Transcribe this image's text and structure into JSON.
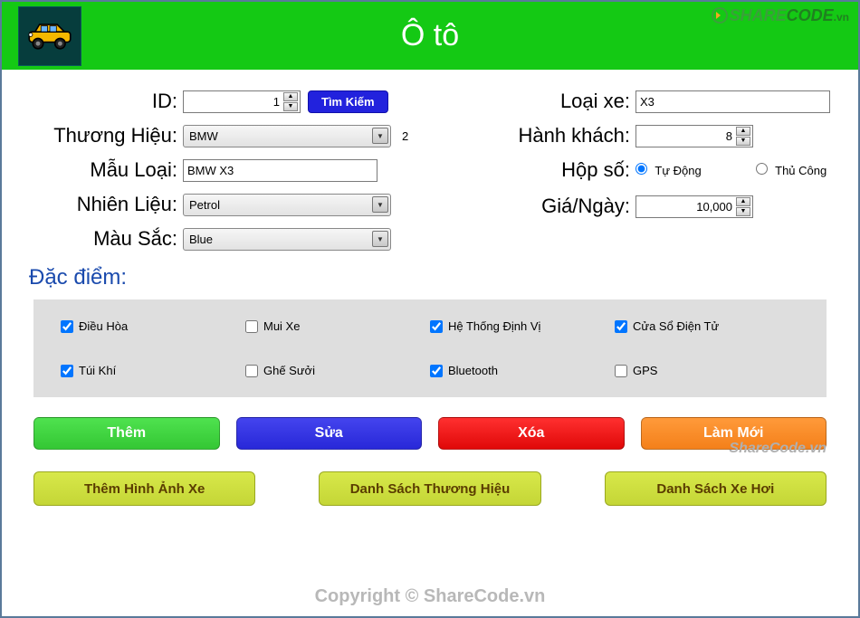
{
  "header": {
    "title": "Ô tô"
  },
  "watermarks": {
    "top_share": "SHARE",
    "top_code": "CODE",
    "top_vn": ".vn",
    "mid": "ShareCode.vn",
    "copyright": "Copyright © ShareCode.vn"
  },
  "labels": {
    "id": "ID:",
    "brand": "Thương Hiệu:",
    "model": "Mẫu Loại:",
    "fuel": "Nhiên Liệu:",
    "color": "Màu Sắc:",
    "car_type": "Loại xe:",
    "passengers": "Hành khách:",
    "gearbox": "Hộp số:",
    "price_day": "Giá/Ngày:",
    "features": "Đặc điểm:"
  },
  "values": {
    "id": "1",
    "brand": "BMW",
    "brand_side": "2",
    "model": "BMW X3",
    "fuel": "Petrol",
    "color": "Blue",
    "car_type": "X3",
    "passengers": "8",
    "price_day": "10,000"
  },
  "gearbox": {
    "auto": "Tự Động",
    "manual": "Thủ Công",
    "selected": "auto"
  },
  "features": [
    {
      "label": "Điều Hòa",
      "checked": true
    },
    {
      "label": "Mui Xe",
      "checked": false
    },
    {
      "label": "Hệ Thống Định Vị",
      "checked": true
    },
    {
      "label": "Cửa Sổ Điện Tử",
      "checked": true
    },
    {
      "label": "Túi Khí",
      "checked": true
    },
    {
      "label": "Ghế Sưởi",
      "checked": false
    },
    {
      "label": "Bluetooth",
      "checked": true
    },
    {
      "label": "GPS",
      "checked": false
    }
  ],
  "buttons": {
    "search": "Tìm Kiếm",
    "add": "Thêm",
    "edit": "Sửa",
    "delete": "Xóa",
    "refresh": "Làm Mới",
    "add_image": "Thêm Hình Ảnh Xe",
    "brand_list": "Danh Sách Thương Hiệu",
    "car_list": "Danh Sách Xe Hơi"
  }
}
